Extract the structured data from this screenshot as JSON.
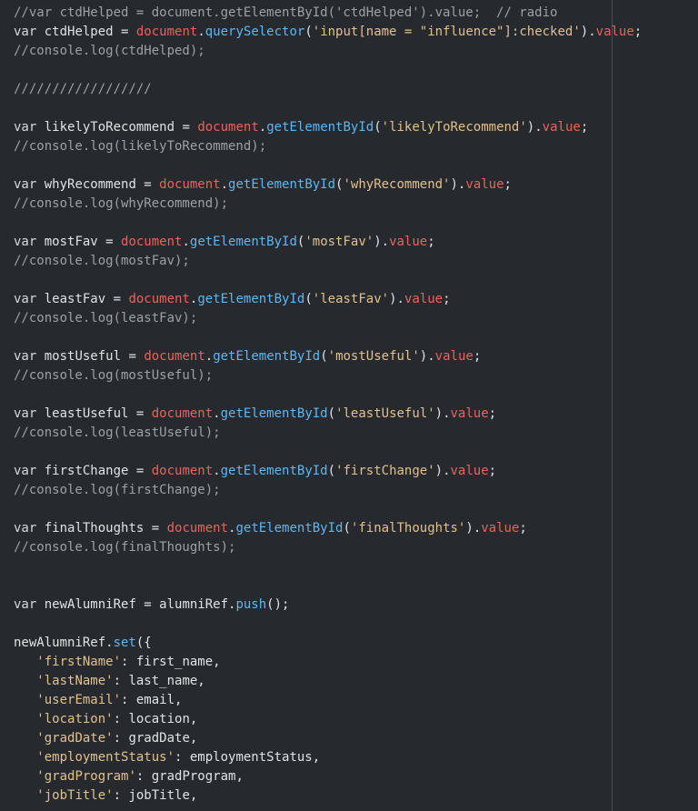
{
  "colors": {
    "background": "#262a2f",
    "comment": "#9aa1a8",
    "keyword": "#d6dadf",
    "object": "#e8645a",
    "function": "#5fb6f0",
    "string": "#e2c08d",
    "ruler": "#4a4f55"
  },
  "lines": [
    [
      {
        "t": "//var ctdHelped = document.getElementById('ctdHelped').value;  // radio",
        "k": "comment"
      }
    ],
    [
      {
        "t": "var",
        "k": "kw"
      },
      {
        "t": " ctdHelped = ",
        "k": "ident"
      },
      {
        "t": "document",
        "k": "obj"
      },
      {
        "t": ".",
        "k": "punct"
      },
      {
        "t": "querySelector",
        "k": "fn"
      },
      {
        "t": "(",
        "k": "punct"
      },
      {
        "t": "'input[name = \"influence\"]:checked'",
        "k": "str"
      },
      {
        "t": ").",
        "k": "punct"
      },
      {
        "t": "value",
        "k": "prop"
      },
      {
        "t": ";",
        "k": "punct"
      }
    ],
    [
      {
        "t": "//console.log(ctdHelped);",
        "k": "comment"
      }
    ],
    [],
    [
      {
        "t": "//////////////////",
        "k": "comment"
      }
    ],
    [],
    [
      {
        "t": "var",
        "k": "kw"
      },
      {
        "t": " likelyToRecommend = ",
        "k": "ident"
      },
      {
        "t": "document",
        "k": "obj"
      },
      {
        "t": ".",
        "k": "punct"
      },
      {
        "t": "getElementById",
        "k": "fn"
      },
      {
        "t": "(",
        "k": "punct"
      },
      {
        "t": "'likelyToRecommend'",
        "k": "str"
      },
      {
        "t": ").",
        "k": "punct"
      },
      {
        "t": "value",
        "k": "prop"
      },
      {
        "t": ";",
        "k": "punct"
      }
    ],
    [
      {
        "t": "//console.log(likelyToRecommend);",
        "k": "comment"
      }
    ],
    [],
    [
      {
        "t": "var",
        "k": "kw"
      },
      {
        "t": " whyRecommend = ",
        "k": "ident"
      },
      {
        "t": "document",
        "k": "obj"
      },
      {
        "t": ".",
        "k": "punct"
      },
      {
        "t": "getElementById",
        "k": "fn"
      },
      {
        "t": "(",
        "k": "punct"
      },
      {
        "t": "'whyRecommend'",
        "k": "str"
      },
      {
        "t": ").",
        "k": "punct"
      },
      {
        "t": "value",
        "k": "prop"
      },
      {
        "t": ";",
        "k": "punct"
      }
    ],
    [
      {
        "t": "//console.log(whyRecommend);",
        "k": "comment"
      }
    ],
    [],
    [
      {
        "t": "var",
        "k": "kw"
      },
      {
        "t": " mostFav = ",
        "k": "ident"
      },
      {
        "t": "document",
        "k": "obj"
      },
      {
        "t": ".",
        "k": "punct"
      },
      {
        "t": "getElementById",
        "k": "fn"
      },
      {
        "t": "(",
        "k": "punct"
      },
      {
        "t": "'mostFav'",
        "k": "str"
      },
      {
        "t": ").",
        "k": "punct"
      },
      {
        "t": "value",
        "k": "prop"
      },
      {
        "t": ";",
        "k": "punct"
      }
    ],
    [
      {
        "t": "//console.log(mostFav);",
        "k": "comment"
      }
    ],
    [],
    [
      {
        "t": "var",
        "k": "kw"
      },
      {
        "t": " leastFav = ",
        "k": "ident"
      },
      {
        "t": "document",
        "k": "obj"
      },
      {
        "t": ".",
        "k": "punct"
      },
      {
        "t": "getElementById",
        "k": "fn"
      },
      {
        "t": "(",
        "k": "punct"
      },
      {
        "t": "'leastFav'",
        "k": "str"
      },
      {
        "t": ").",
        "k": "punct"
      },
      {
        "t": "value",
        "k": "prop"
      },
      {
        "t": ";",
        "k": "punct"
      }
    ],
    [
      {
        "t": "//console.log(leastFav);",
        "k": "comment"
      }
    ],
    [],
    [
      {
        "t": "var",
        "k": "kw"
      },
      {
        "t": " mostUseful = ",
        "k": "ident"
      },
      {
        "t": "document",
        "k": "obj"
      },
      {
        "t": ".",
        "k": "punct"
      },
      {
        "t": "getElementById",
        "k": "fn"
      },
      {
        "t": "(",
        "k": "punct"
      },
      {
        "t": "'mostUseful'",
        "k": "str"
      },
      {
        "t": ").",
        "k": "punct"
      },
      {
        "t": "value",
        "k": "prop"
      },
      {
        "t": ";",
        "k": "punct"
      }
    ],
    [
      {
        "t": "//console.log(mostUseful);",
        "k": "comment"
      }
    ],
    [],
    [
      {
        "t": "var",
        "k": "kw"
      },
      {
        "t": " leastUseful = ",
        "k": "ident"
      },
      {
        "t": "document",
        "k": "obj"
      },
      {
        "t": ".",
        "k": "punct"
      },
      {
        "t": "getElementById",
        "k": "fn"
      },
      {
        "t": "(",
        "k": "punct"
      },
      {
        "t": "'leastUseful'",
        "k": "str"
      },
      {
        "t": ").",
        "k": "punct"
      },
      {
        "t": "value",
        "k": "prop"
      },
      {
        "t": ";",
        "k": "punct"
      }
    ],
    [
      {
        "t": "//console.log(leastUseful);",
        "k": "comment"
      }
    ],
    [],
    [
      {
        "t": "var",
        "k": "kw"
      },
      {
        "t": " firstChange = ",
        "k": "ident"
      },
      {
        "t": "document",
        "k": "obj"
      },
      {
        "t": ".",
        "k": "punct"
      },
      {
        "t": "getElementById",
        "k": "fn"
      },
      {
        "t": "(",
        "k": "punct"
      },
      {
        "t": "'firstChange'",
        "k": "str"
      },
      {
        "t": ").",
        "k": "punct"
      },
      {
        "t": "value",
        "k": "prop"
      },
      {
        "t": ";",
        "k": "punct"
      }
    ],
    [
      {
        "t": "//console.log(firstChange);",
        "k": "comment"
      }
    ],
    [],
    [
      {
        "t": "var",
        "k": "kw"
      },
      {
        "t": " finalThoughts = ",
        "k": "ident"
      },
      {
        "t": "document",
        "k": "obj"
      },
      {
        "t": ".",
        "k": "punct"
      },
      {
        "t": "getElementById",
        "k": "fn"
      },
      {
        "t": "(",
        "k": "punct"
      },
      {
        "t": "'finalThoughts'",
        "k": "str"
      },
      {
        "t": ").",
        "k": "punct"
      },
      {
        "t": "value",
        "k": "prop"
      },
      {
        "t": ";",
        "k": "punct"
      }
    ],
    [
      {
        "t": "//console.log(finalThoughts);",
        "k": "comment"
      }
    ],
    [],
    [],
    [
      {
        "t": "var",
        "k": "kw"
      },
      {
        "t": " newAlumniRef = alumniRef.",
        "k": "ident"
      },
      {
        "t": "push",
        "k": "fn"
      },
      {
        "t": "();",
        "k": "punct"
      }
    ],
    [],
    [
      {
        "t": "newAlumniRef.",
        "k": "ident"
      },
      {
        "t": "set",
        "k": "fn"
      },
      {
        "t": "({",
        "k": "punct"
      }
    ],
    [
      {
        "t": "   ",
        "k": "ident"
      },
      {
        "t": "'firstName'",
        "k": "key"
      },
      {
        "t": ": first_name,",
        "k": "ident"
      }
    ],
    [
      {
        "t": "   ",
        "k": "ident"
      },
      {
        "t": "'lastName'",
        "k": "key"
      },
      {
        "t": ": last_name,",
        "k": "ident"
      }
    ],
    [
      {
        "t": "   ",
        "k": "ident"
      },
      {
        "t": "'userEmail'",
        "k": "key"
      },
      {
        "t": ": email,",
        "k": "ident"
      }
    ],
    [
      {
        "t": "   ",
        "k": "ident"
      },
      {
        "t": "'location'",
        "k": "key"
      },
      {
        "t": ": location,",
        "k": "ident"
      }
    ],
    [
      {
        "t": "   ",
        "k": "ident"
      },
      {
        "t": "'gradDate'",
        "k": "key"
      },
      {
        "t": ": gradDate,",
        "k": "ident"
      }
    ],
    [
      {
        "t": "   ",
        "k": "ident"
      },
      {
        "t": "'employmentStatus'",
        "k": "key"
      },
      {
        "t": ": employmentStatus,",
        "k": "ident"
      }
    ],
    [
      {
        "t": "   ",
        "k": "ident"
      },
      {
        "t": "'gradProgram'",
        "k": "key"
      },
      {
        "t": ": gradProgram,",
        "k": "ident"
      }
    ],
    [
      {
        "t": "   ",
        "k": "ident"
      },
      {
        "t": "'jobTitle'",
        "k": "key"
      },
      {
        "t": ": jobTitle,",
        "k": "ident"
      }
    ]
  ]
}
